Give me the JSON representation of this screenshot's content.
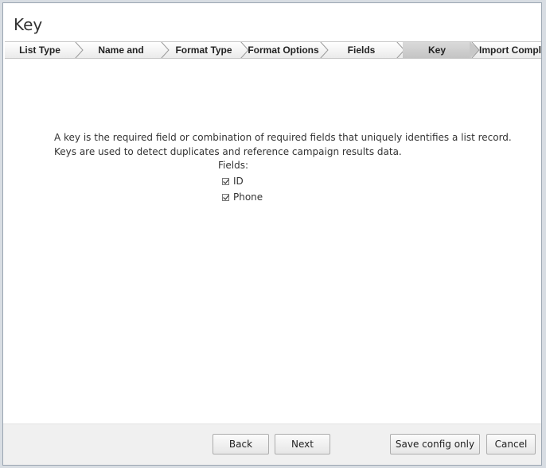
{
  "window": {
    "title": "Key"
  },
  "wizard": {
    "steps": [
      {
        "label": "List Type"
      },
      {
        "label": "Name and Source"
      },
      {
        "label": "Format Type"
      },
      {
        "label": "Format Options"
      },
      {
        "label": "Fields"
      },
      {
        "label": "Key",
        "active": true
      },
      {
        "label": "Import Complete"
      }
    ]
  },
  "content": {
    "description_line1": "A key is the required field or combination of required fields that uniquely identifies a list record.",
    "description_line2": "Keys are used to detect duplicates and reference campaign results data.",
    "fields_label": "Fields:",
    "fields": [
      {
        "label": "ID",
        "checked": true
      },
      {
        "label": "Phone",
        "checked": true
      }
    ]
  },
  "footer": {
    "back_label": "Back",
    "next_label": "Next",
    "save_config_label": "Save config only",
    "cancel_label": "Cancel"
  }
}
